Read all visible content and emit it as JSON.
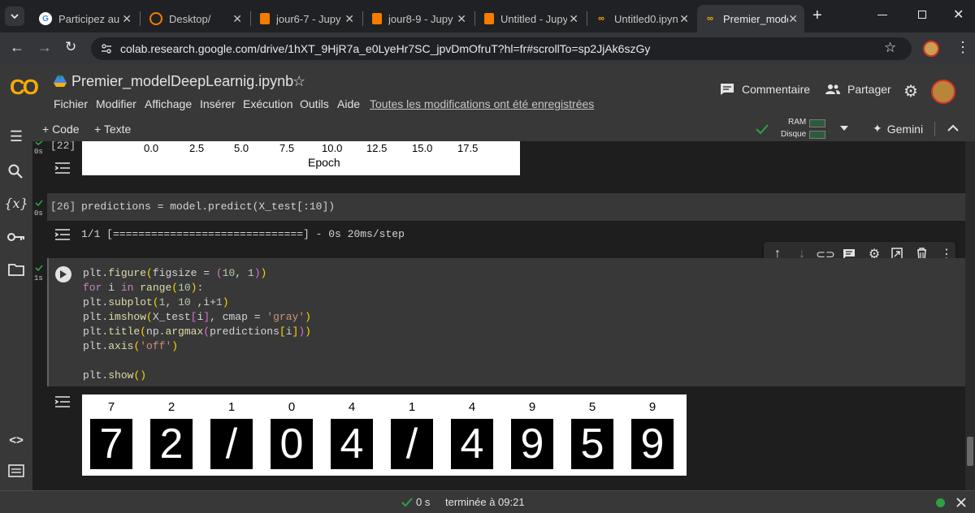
{
  "browser": {
    "tabs": [
      {
        "title": "Participez au c",
        "favicon_color": "#4285f4"
      },
      {
        "title": "Desktop/",
        "favicon_color": "#f57c00"
      },
      {
        "title": "jour6-7 - Jupy",
        "favicon_color": "#f57c00"
      },
      {
        "title": "jour8-9 - Jupy",
        "favicon_color": "#f57c00"
      },
      {
        "title": "Untitled - Jupy",
        "favicon_color": "#f57c00"
      },
      {
        "title": "Untitled0.ipyn",
        "favicon_color": "#f9ab00"
      },
      {
        "title": "Premier_mode",
        "favicon_color": "#f9ab00"
      }
    ],
    "new_tab": "+",
    "url": "colab.research.google.com/drive/1hXT_9HjR7a_e0LyeHr7SC_jpvDmOfruT?hl=fr#scrollTo=sp2JjAk6szGy"
  },
  "colab": {
    "logo": "CO",
    "notebook_title": "Premier_modelDeepLearnig.ipynb",
    "menus": [
      "Fichier",
      "Modifier",
      "Affichage",
      "Insérer",
      "Exécution",
      "Outils",
      "Aide"
    ],
    "save_status": "Toutes les modifications ont été enregistrées",
    "comment_label": "Commentaire",
    "share_label": "Partager",
    "add_code": "+ Code",
    "add_text": "+ Texte",
    "ram_label": "RAM",
    "disk_label": "Disque",
    "gemini_label": "Gemini"
  },
  "cells": {
    "cell22": {
      "exec_count": "[22]",
      "exec_time": "0s",
      "xtick_labels": [
        "0.0",
        "2.5",
        "5.0",
        "7.5",
        "10.0",
        "12.5",
        "15.0",
        "17.5"
      ],
      "xlabel": "Epoch"
    },
    "cell26": {
      "exec_count": "[26]",
      "exec_time": "0s",
      "code": "predictions = model.predict(X_test[:10])",
      "output": "1/1 [==============================] - 0s 20ms/step"
    },
    "cell_current": {
      "exec_time": "1s",
      "code_lines": [
        "plt.figure(figsize = (10, 1))",
        "for i in range(10):",
        "  plt.subplot(1, 10 ,i+1)",
        "  plt.imshow(X_test[i], cmap = 'gray')",
        "  plt.title(np.argmax(predictions[i]))",
        "  plt.axis('off')",
        "",
        "plt.show()"
      ],
      "predicted_titles": [
        "7",
        "2",
        "1",
        "0",
        "4",
        "1",
        "4",
        "9",
        "5",
        "9"
      ],
      "images_digits": [
        "7",
        "2",
        "/",
        "0",
        "4",
        "/",
        "4",
        "9",
        "5",
        "9"
      ]
    }
  },
  "status": {
    "time": "0 s",
    "completed": "terminée à 09:21"
  }
}
